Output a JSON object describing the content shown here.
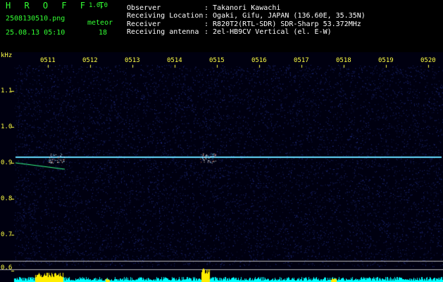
{
  "app": {
    "logo": "H R O F F T",
    "version": "1.0.0"
  },
  "file": {
    "name": "2508130510.png",
    "datetime": "25.08.13 05:10"
  },
  "meteor": {
    "label": "meteor",
    "count": "18"
  },
  "info": [
    {
      "key": "Observer",
      "value": ": Takanori Kawachi"
    },
    {
      "key": "Receiving Location",
      "value": ": Ogaki, Gifu, JAPAN (136.60E, 35.35N)"
    },
    {
      "key": "Receiver",
      "value": ": R820T2(RTL-SDR) SDR-Sharp 53.372MHz"
    },
    {
      "key": "Receiving antenna",
      "value": ": 2el-HB9CV Vertical (el. E-W)"
    }
  ],
  "axis": {
    "unit": "kHz",
    "x_ticks": [
      "0511",
      "0512",
      "0513",
      "0514",
      "0515",
      "0516",
      "0517",
      "0518",
      "0519",
      "0520"
    ],
    "y_ticks": [
      "1.1",
      "1.0",
      "0.9",
      "0.8",
      "0.7",
      "0.6"
    ]
  },
  "colors": {
    "background": "#000000",
    "header_green": "#33ff33",
    "tick_yellow": "#ffff44",
    "noise_blue": "#1a2a8a",
    "carrier_cyan": "#66ddff",
    "activity_cyan": "#00ffff",
    "activity_yellow": "#ffee00"
  }
}
